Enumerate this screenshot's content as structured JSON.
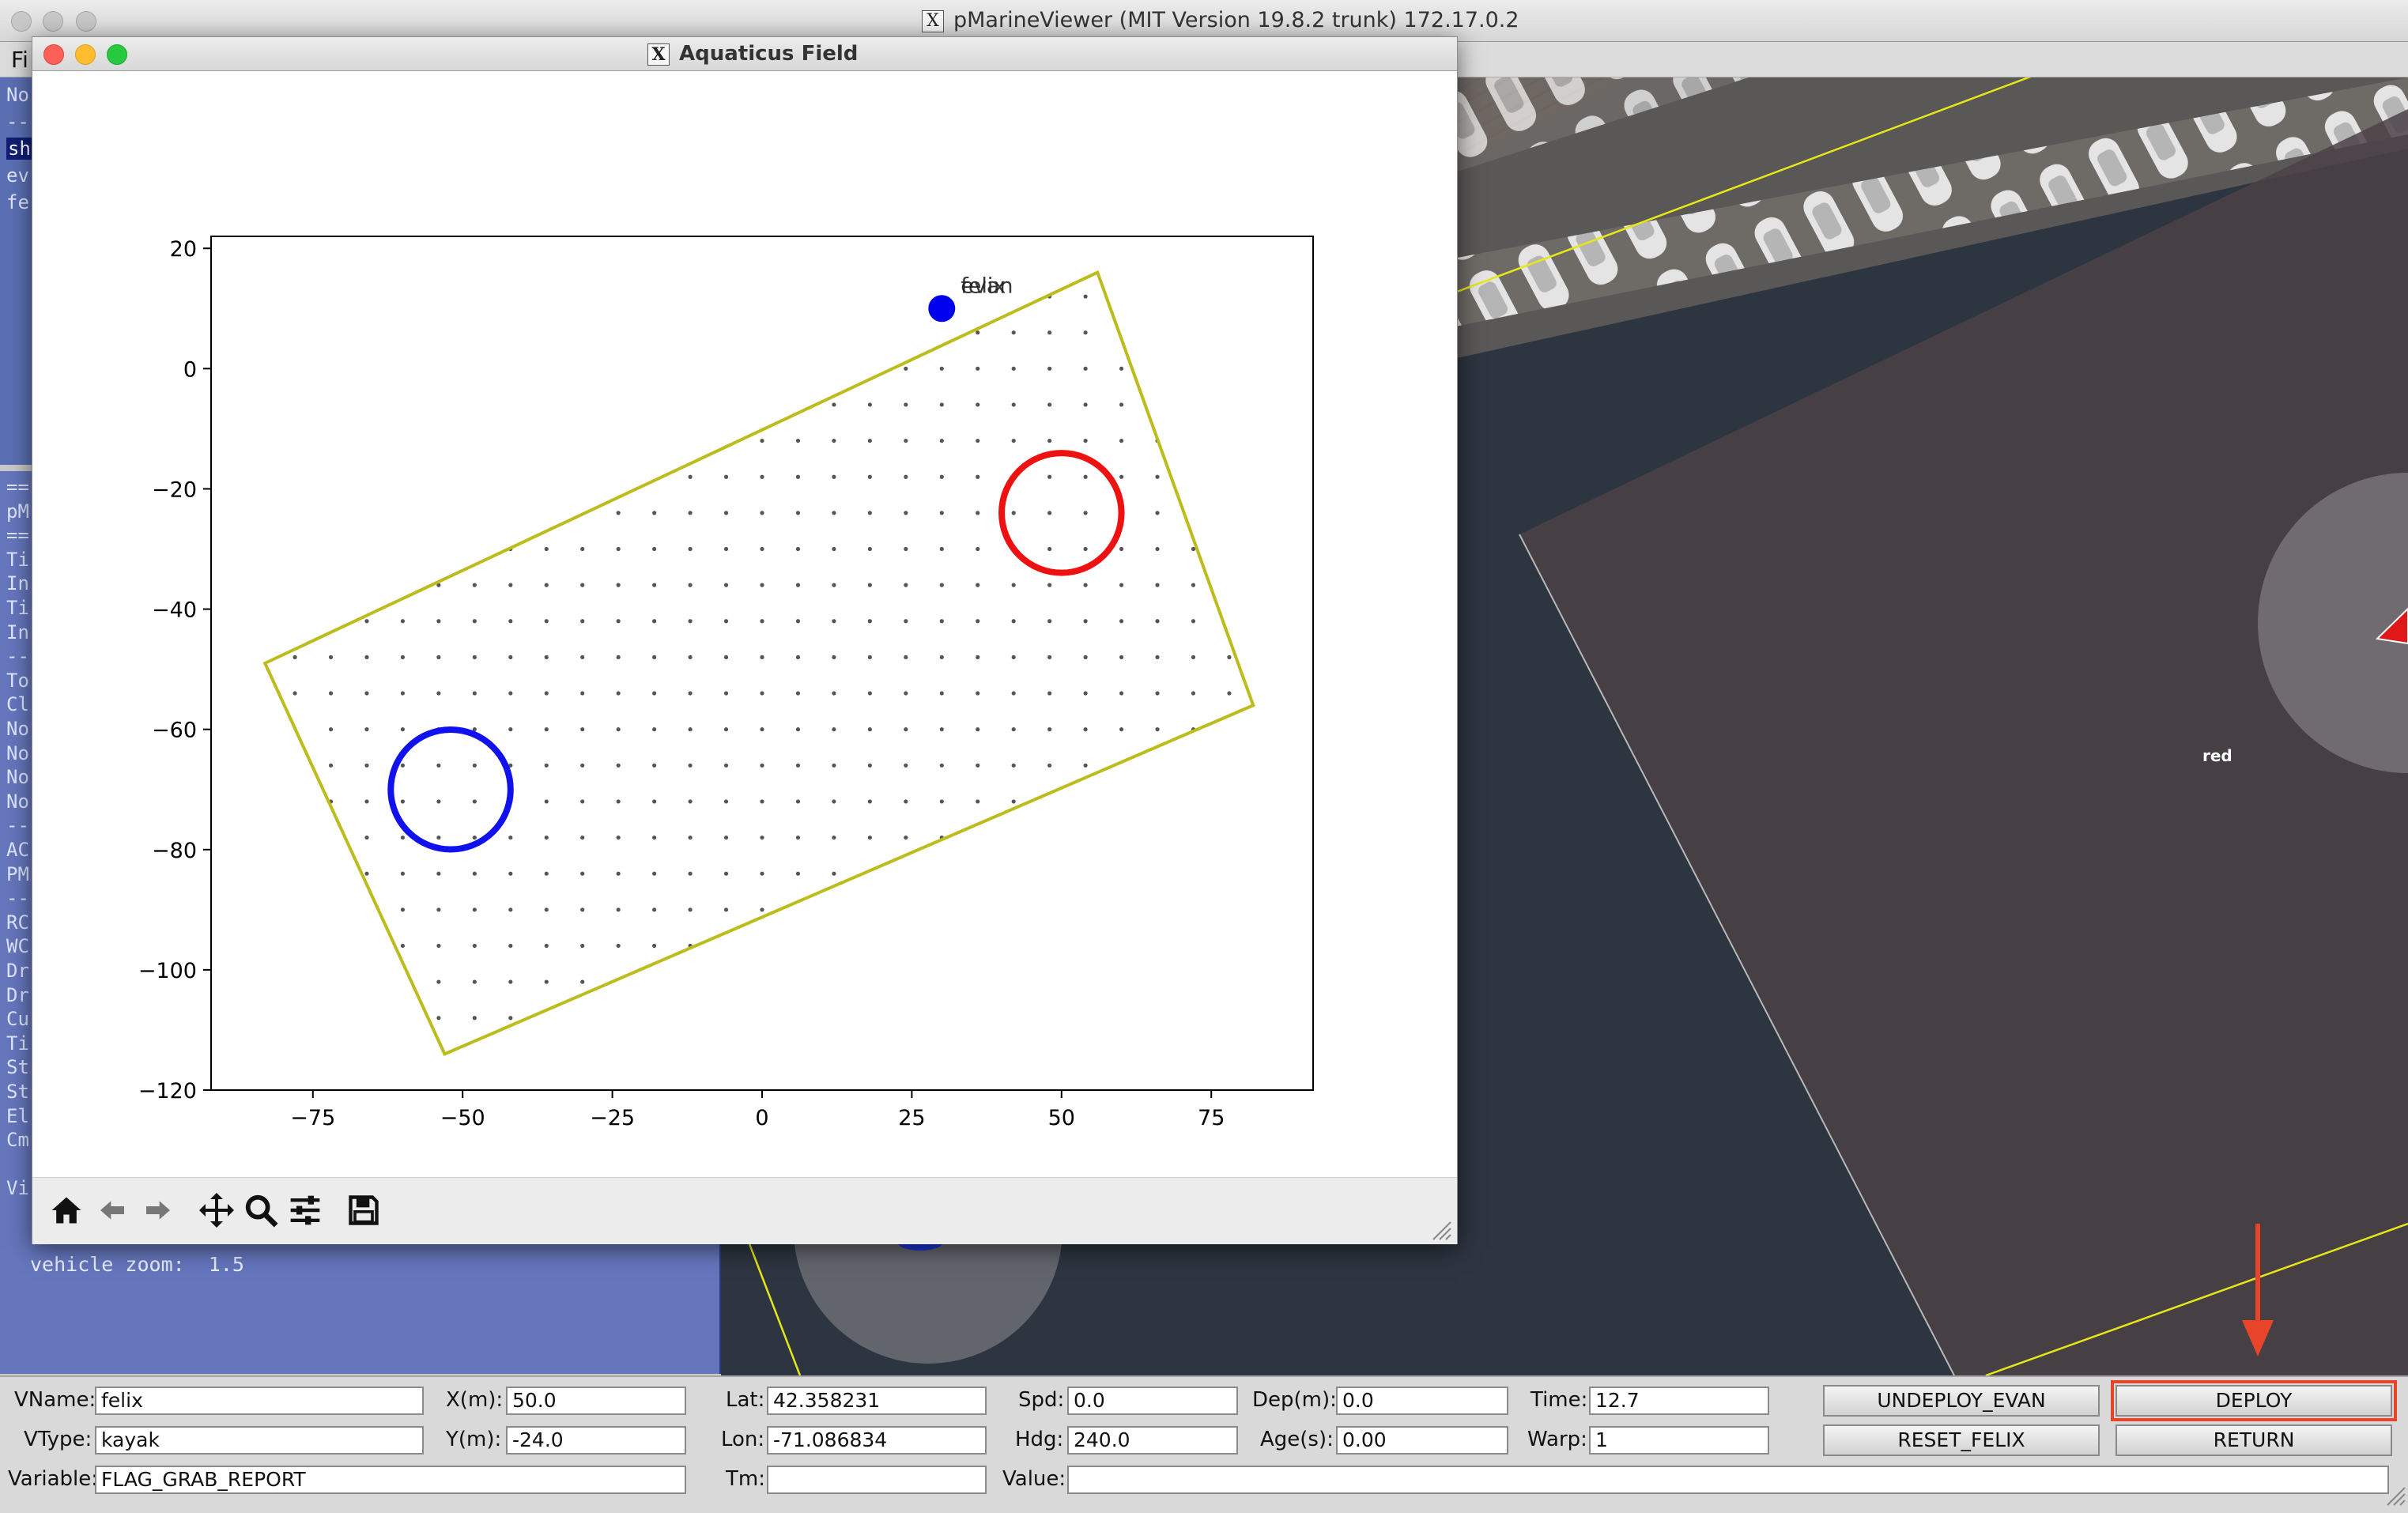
{
  "main_window": {
    "title": "pMarineViewer (MIT Version 19.8.2 trunk) 172.17.0.2"
  },
  "menu": {
    "first_item": "Fi"
  },
  "left_panel_top": {
    "lines": [
      "No",
      "--",
      "sh",
      "ev",
      "fe"
    ],
    "selected_index": 2
  },
  "left_panel_bottom": {
    "lines": [
      "==",
      "pM",
      "==",
      "Ti",
      "In",
      "Ti",
      "In",
      "--",
      "To",
      "Cl",
      "No",
      "No",
      "No",
      "No",
      "--",
      "AC",
      "PM",
      "--",
      "RC",
      "WC",
      "Dr",
      "Dr",
      "Cu",
      "Ti",
      "St",
      "St",
      "El",
      "Cm",
      "",
      "Vi"
    ],
    "zoom_line": "vehicle zoom:  1.5"
  },
  "map": {
    "red_label": "red"
  },
  "aquaticus_window": {
    "title": "Aquaticus Field",
    "toolbar_icons": [
      "home-icon",
      "back-arrow-icon",
      "forward-arrow-icon",
      "pan-icon",
      "zoom-icon",
      "configure-icon",
      "save-icon"
    ]
  },
  "chart_data": {
    "type": "scatter",
    "title": "",
    "xlabel": "",
    "ylabel": "",
    "xlim": [
      -92,
      92
    ],
    "ylim": [
      -120,
      22
    ],
    "xticks": [
      -75,
      -50,
      -25,
      0,
      25,
      50,
      75
    ],
    "yticks": [
      20,
      0,
      -20,
      -40,
      -60,
      -80,
      -100,
      -120
    ],
    "xtick_labels": [
      "−75",
      "−50",
      "−25",
      "0",
      "25",
      "50",
      "75"
    ],
    "ytick_labels": [
      "20",
      "0",
      "−20",
      "−40",
      "−60",
      "−80",
      "−100",
      "−120"
    ],
    "field_boundary": [
      [
        -83,
        -49
      ],
      [
        56,
        16
      ],
      [
        82,
        -56
      ],
      [
        -53,
        -114
      ]
    ],
    "field_boundary_color": "#bcbc1c",
    "flags": [
      {
        "team": "red",
        "x": 50,
        "y": -24,
        "radius": 10,
        "color": "#ee1111"
      },
      {
        "team": "blue",
        "x": -52,
        "y": -70,
        "radius": 10,
        "color": "#1111ee"
      }
    ],
    "vehicles": [
      {
        "x": 30,
        "y": 10,
        "label": "felix",
        "color": "#0000ee"
      },
      {
        "x": 30,
        "y": 10,
        "label": "evan",
        "color": "#0000ee"
      }
    ],
    "grid_spacing": 6,
    "grid_dot_color": "#555555",
    "grid": false
  },
  "controls": {
    "vname_label": "VName:",
    "vname_value": "felix",
    "vtype_label": "VType:",
    "vtype_value": "kayak",
    "variable_label": "Variable:",
    "variable_value": "FLAG_GRAB_REPORT",
    "x_label": "X(m):",
    "x_value": "50.0",
    "y_label": "Y(m):",
    "y_value": "-24.0",
    "lat_label": "Lat:",
    "lat_value": "42.358231",
    "lon_label": "Lon:",
    "lon_value": "-71.086834",
    "tm_label": "Tm:",
    "tm_value": "",
    "spd_label": "Spd:",
    "spd_value": "0.0",
    "hdg_label": "Hdg:",
    "hdg_value": "240.0",
    "dep_label": "Dep(m):",
    "dep_value": "0.0",
    "age_label": "Age(s):",
    "age_value": "0.00",
    "value_label": "Value:",
    "value_value": "",
    "time_label": "Time:",
    "time_value": "12.7",
    "warp_label": "Warp:",
    "warp_value": "1",
    "undeploy_evan": "UNDEPLOY_EVAN",
    "deploy": "DEPLOY",
    "reset_felix": "RESET_FELIX",
    "return": "RETURN"
  },
  "annotation_color": "#e8442a"
}
